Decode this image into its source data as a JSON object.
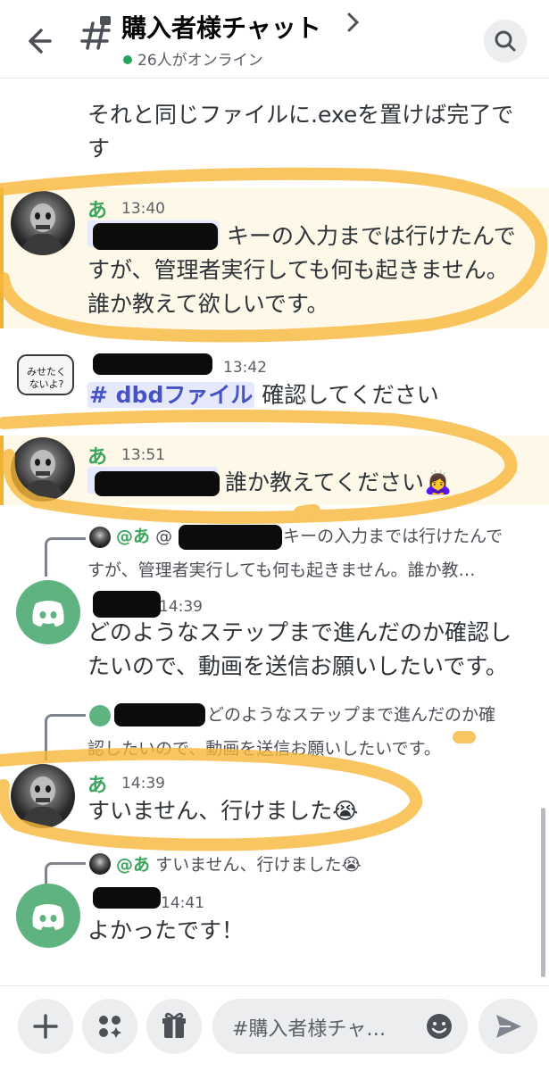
{
  "header": {
    "channel_name": "購入者様チャット",
    "online_text": "26人がオンライン"
  },
  "messages": [
    {
      "id": "m0",
      "text_line1": "それと同じファイルに.exeを置けば完了で",
      "text_line2": "す"
    },
    {
      "id": "m1",
      "author": "あ",
      "time": "13:40",
      "line1_tail": "キーの入力までは行けたんで",
      "line2": "すが、管理者実行しても何も起きません。",
      "line3": "誰か教えて欲しいです。"
    },
    {
      "id": "m2",
      "time": "13:42",
      "sticker_text_1": "みせたく",
      "sticker_text_2": "ないよ?",
      "channel_mention": "# dbdファイル",
      "text_tail": "確認してください"
    },
    {
      "id": "m3",
      "author": "あ",
      "time": "13:51",
      "text_tail": "誰か教えてください🙇‍♀️"
    },
    {
      "id": "m4",
      "reply_name": "@あ",
      "reply_prefix": "@",
      "reply_text_1": "キーの入力までは行けたんで",
      "reply_text_2": "すが、管理者実行しても何も起きません。誰か教…",
      "time": "14:39",
      "line1": "どのようなステップまで進んだのか確認し",
      "line2": "たいので、動画を送信お願いしたいです。"
    },
    {
      "id": "m5",
      "reply_text_1": "どのようなステップまで進んだのか確",
      "reply_text_2": "認したいので、動画を送信お願いしたいです。",
      "author": "あ",
      "time": "14:39",
      "text": "すいません、行けました😭"
    },
    {
      "id": "m6",
      "reply_name": "@あ",
      "reply_text": "すいません、行けました😭",
      "time": "14:41",
      "text": "よかったです！"
    }
  ],
  "composer": {
    "placeholder": "#購入者様チャ…"
  },
  "colors": {
    "accent_green": "#3ba55d",
    "highlight_bg": "#fdf8e7",
    "highlight_bar": "#f0b232",
    "marker": "#f7b739",
    "mention": "#5865f2"
  }
}
